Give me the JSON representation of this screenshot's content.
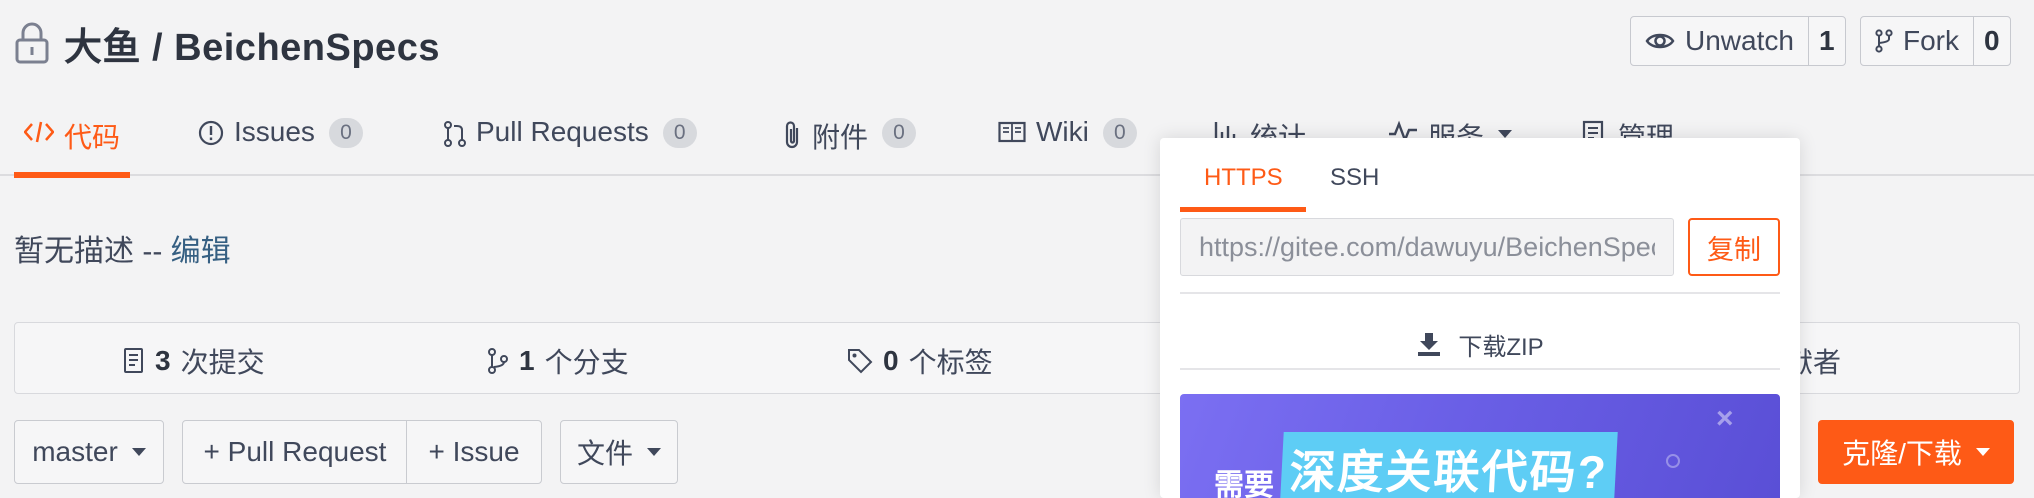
{
  "repo": {
    "owner": "大鱼",
    "separator": "/",
    "name": "BeichenSpecs",
    "title": "大鱼 / BeichenSpecs"
  },
  "watch": {
    "label": "Unwatch",
    "count": "1"
  },
  "fork": {
    "label": "Fork",
    "count": "0"
  },
  "tabs": [
    {
      "label": "代码",
      "icon": "code-icon"
    },
    {
      "label": "Issues",
      "badge": "0",
      "icon": "issue-icon"
    },
    {
      "label": "Pull Requests",
      "badge": "0",
      "icon": "pull-request-icon"
    },
    {
      "label": "附件",
      "badge": "0",
      "icon": "paperclip-icon"
    },
    {
      "label": "Wiki",
      "badge": "0",
      "icon": "book-icon"
    },
    {
      "label": "统计",
      "icon": "bar-chart-icon"
    },
    {
      "label": "服务",
      "icon": "pulse-icon"
    },
    {
      "label": "管理",
      "icon": "settings-doc-icon"
    }
  ],
  "description": {
    "text": "暂无描述 -- ",
    "edit": "编辑"
  },
  "stats": {
    "commits": {
      "count": "3",
      "label": "次提交"
    },
    "branches": {
      "count": "1",
      "label": "个分支"
    },
    "tags": {
      "count": "0",
      "label": "个标签"
    },
    "contributors_tail": "献者"
  },
  "actions": {
    "branch": "master",
    "pull_request": "+ Pull Request",
    "issue": "+ Issue",
    "files": "文件",
    "clone": "克隆/下载"
  },
  "clone_popup": {
    "tabs": [
      "HTTPS",
      "SSH"
    ],
    "url": "https://gitee.com/dawuyu/BeichenSpecs.git",
    "copy": "复制",
    "download_zip": "下载ZIP",
    "banner_need": "需要",
    "banner_highlight": "深度关联代码?"
  },
  "colors": {
    "accent": "#fe5a16",
    "link": "#355f82",
    "banner": "#6a5fe6"
  }
}
